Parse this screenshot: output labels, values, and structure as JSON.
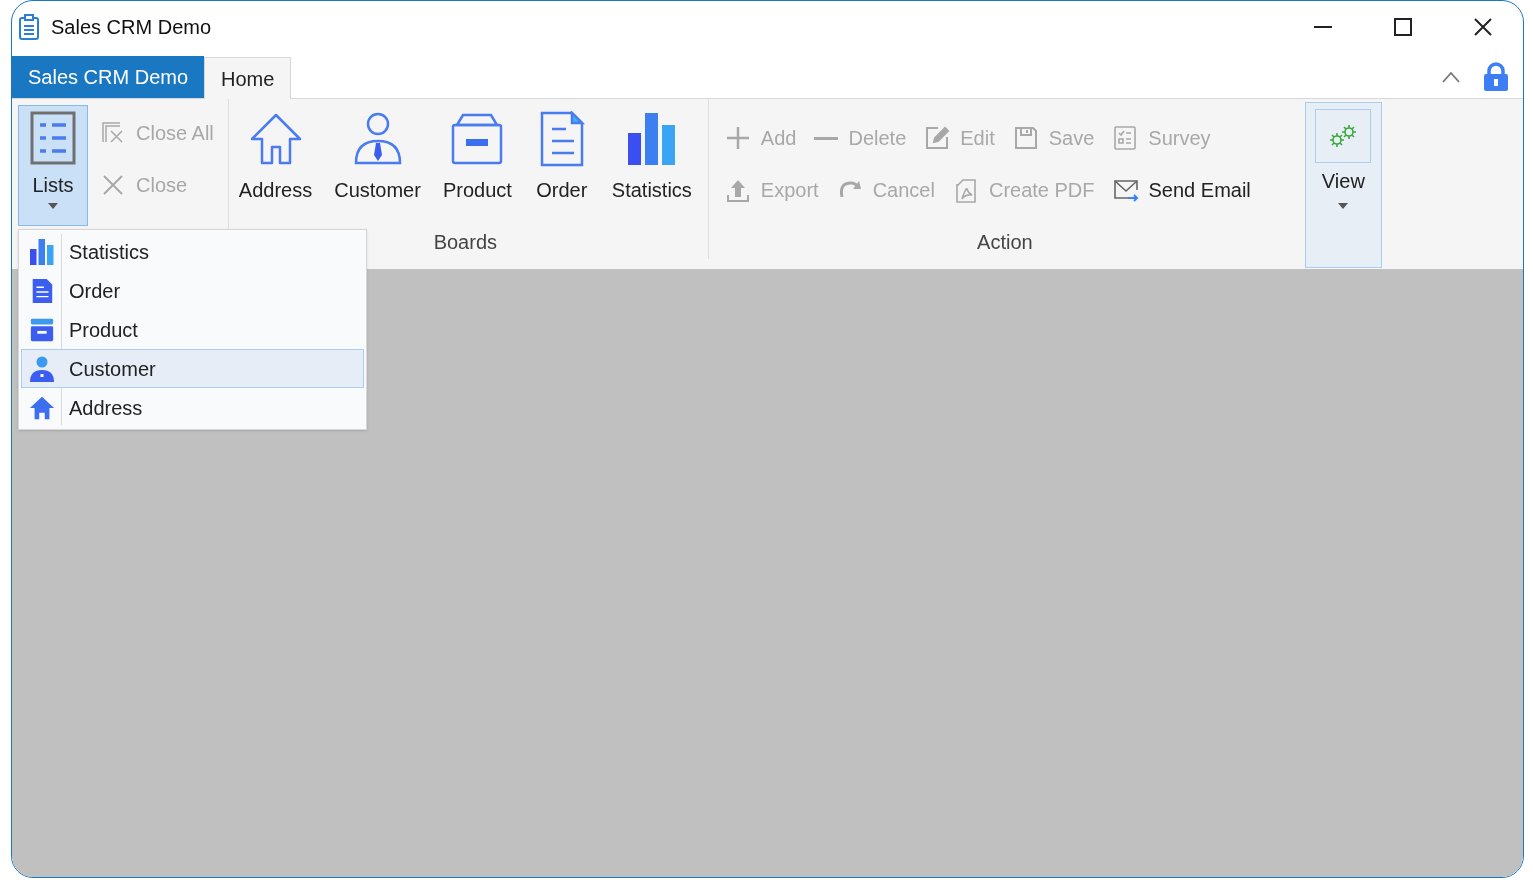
{
  "window": {
    "title": "Sales CRM Demo"
  },
  "app_menu": {
    "label": "Sales CRM Demo"
  },
  "tabs": [
    {
      "label": "Home",
      "selected": true
    }
  ],
  "lists_group": {
    "lists_button": {
      "label": "Lists",
      "expanded": true
    },
    "items": [
      {
        "label": "Close All",
        "kind": "close-all",
        "disabled": true
      },
      {
        "label": "Close",
        "kind": "close",
        "disabled": true
      }
    ]
  },
  "boards_group": {
    "label": "Boards",
    "items": [
      {
        "label": "Address",
        "kind": "house"
      },
      {
        "label": "Customer",
        "kind": "person"
      },
      {
        "label": "Product",
        "kind": "box"
      },
      {
        "label": "Order",
        "kind": "document"
      },
      {
        "label": "Statistics",
        "kind": "bars"
      }
    ]
  },
  "action_group": {
    "label": "Action",
    "items": [
      {
        "label": "Add",
        "kind": "plus",
        "disabled": true
      },
      {
        "label": "Delete",
        "kind": "minus",
        "disabled": true
      },
      {
        "label": "Edit",
        "kind": "pencil",
        "disabled": true
      },
      {
        "label": "Save",
        "kind": "floppy",
        "disabled": true
      },
      {
        "label": "Survey",
        "kind": "checklist",
        "disabled": true
      },
      {
        "label": "Export",
        "kind": "upload",
        "disabled": true
      },
      {
        "label": "Cancel",
        "kind": "redo",
        "disabled": true
      },
      {
        "label": "Create PDF",
        "kind": "pdf",
        "disabled": true
      },
      {
        "label": "Send Email",
        "kind": "envelope",
        "disabled": false
      }
    ]
  },
  "view_button": {
    "label": "View",
    "highlighted": true
  },
  "lists_menu": [
    {
      "label": "Statistics",
      "kind": "bars",
      "selected": false
    },
    {
      "label": "Order",
      "kind": "document",
      "selected": false
    },
    {
      "label": "Product",
      "kind": "box",
      "selected": false
    },
    {
      "label": "Customer",
      "kind": "person",
      "selected": true
    },
    {
      "label": "Address",
      "kind": "house",
      "selected": false
    }
  ]
}
